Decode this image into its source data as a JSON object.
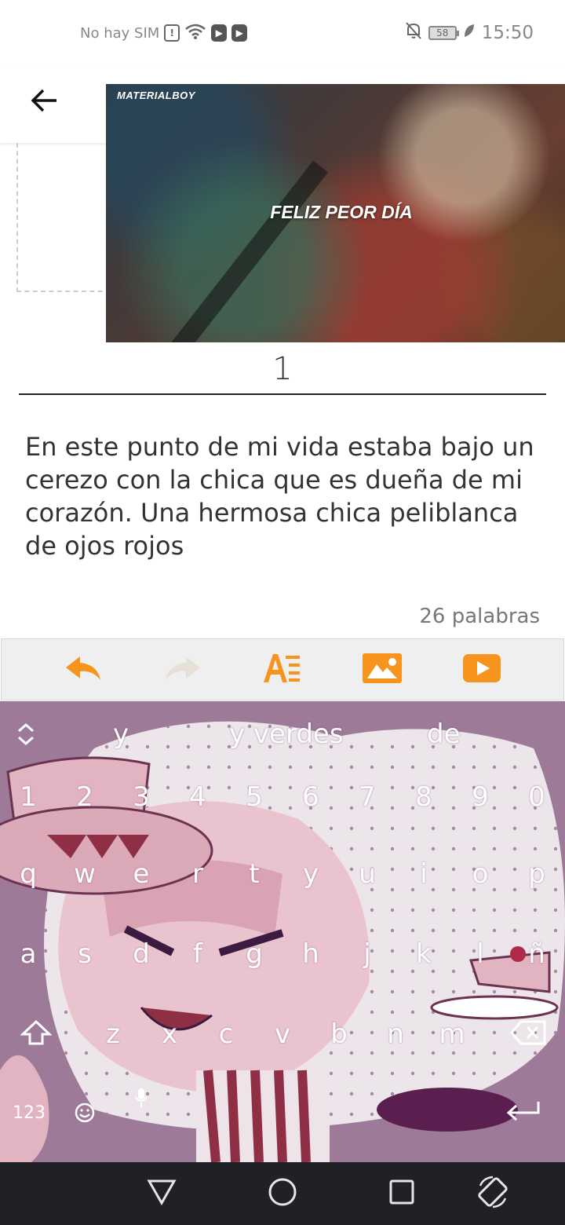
{
  "status_bar": {
    "carrier": "No hay SIM",
    "battery_level": "58",
    "time": "15:50",
    "icons": [
      "sim-alert-icon",
      "wifi-icon",
      "play-store-icon",
      "play-store-icon",
      "bell-off-icon",
      "battery-icon",
      "leaf-icon"
    ]
  },
  "app_bar": {
    "back_icon": "arrow-left-icon"
  },
  "media": {
    "watermark": "MATERIALBOY",
    "caption": "FELIZ PEOR DÍA"
  },
  "chapter": {
    "title": "1",
    "body": "En este punto de mi vida estaba bajo un cerezo con la chica que es dueña de mi corazón. Una hermosa chica peliblanca de ojos rojos",
    "word_count": "26 palabras"
  },
  "toolbar": {
    "accent": "#f7941d",
    "items": [
      {
        "icon": "undo-icon",
        "enabled": true
      },
      {
        "icon": "redo-icon",
        "enabled": false
      },
      {
        "icon": "text-format-icon",
        "enabled": true
      },
      {
        "icon": "image-icon",
        "enabled": true
      },
      {
        "icon": "youtube-icon",
        "enabled": true
      }
    ]
  },
  "keyboard": {
    "suggestions": [
      "y",
      "y verdes",
      "de"
    ],
    "number_row": [
      "1",
      "2",
      "3",
      "4",
      "5",
      "6",
      "7",
      "8",
      "9",
      "0"
    ],
    "row1": [
      "q",
      "w",
      "e",
      "r",
      "t",
      "y",
      "u",
      "i",
      "o",
      "p"
    ],
    "row2": [
      "a",
      "s",
      "d",
      "f",
      "g",
      "h",
      "j",
      "k",
      "l",
      "ñ"
    ],
    "row3": [
      "z",
      "x",
      "c",
      "v",
      "b",
      "n",
      "m"
    ],
    "mode_key": "123"
  },
  "nav_bar": {
    "icons": [
      "back-triangle-icon",
      "home-circle-icon",
      "recents-square-icon",
      "rotate-screen-icon"
    ]
  }
}
